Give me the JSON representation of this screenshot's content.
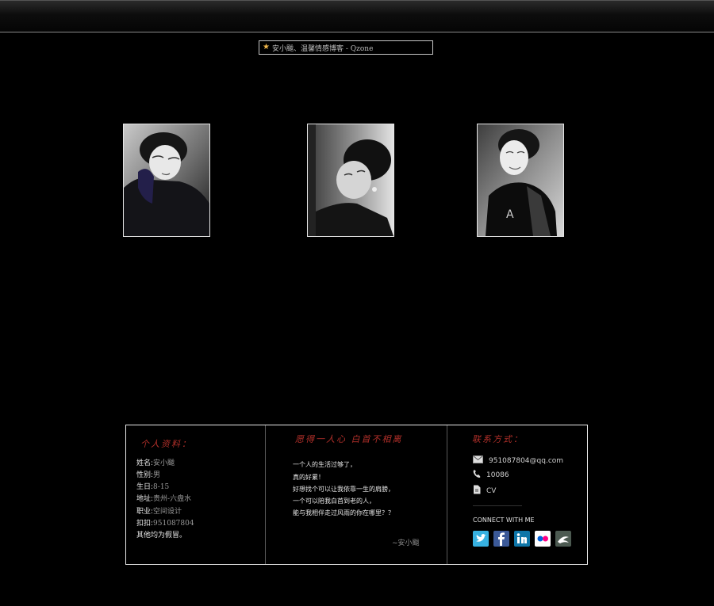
{
  "page_title": "安小颰、温馨情感博客 - Qzone",
  "photos": [
    "photo-1",
    "photo-2",
    "photo-3"
  ],
  "profile": {
    "heading": "个人资料：",
    "lines": [
      {
        "label": "姓名:",
        "value": "安小颰"
      },
      {
        "label": "性别:",
        "value": "男"
      },
      {
        "label": "生日:",
        "value": "8-15"
      },
      {
        "label": "地址:",
        "value": "贵州-六盘水"
      },
      {
        "label": "职业:",
        "value": "空间设计"
      },
      {
        "label": "扣扣:",
        "value": "951087804"
      }
    ],
    "note": "其他均为假冒。"
  },
  "quote": {
    "heading": "愿得一人心 白首不相离",
    "lines": [
      "一个人的生活过够了，",
      "真的好累！",
      "好想找个可以让我依靠一生的肩膀，",
      "一个可以陪我白首到老的人，",
      "能与我相伴走过风雨的你在哪里？？"
    ],
    "signature": "~安小颰"
  },
  "contact": {
    "heading": "联系方式：",
    "email": "951087804@qq.com",
    "phone": "10086",
    "cv": "CV",
    "connect_label": "CONNECT WITH ME",
    "social": [
      {
        "name": "twitter",
        "color": "#37b1e1"
      },
      {
        "name": "facebook",
        "color": "#3b5998"
      },
      {
        "name": "linkedin",
        "color": "#0e76a8"
      },
      {
        "name": "flickr",
        "color": "#ffffff"
      },
      {
        "name": "deviantart",
        "color": "#4c5a51"
      }
    ]
  }
}
